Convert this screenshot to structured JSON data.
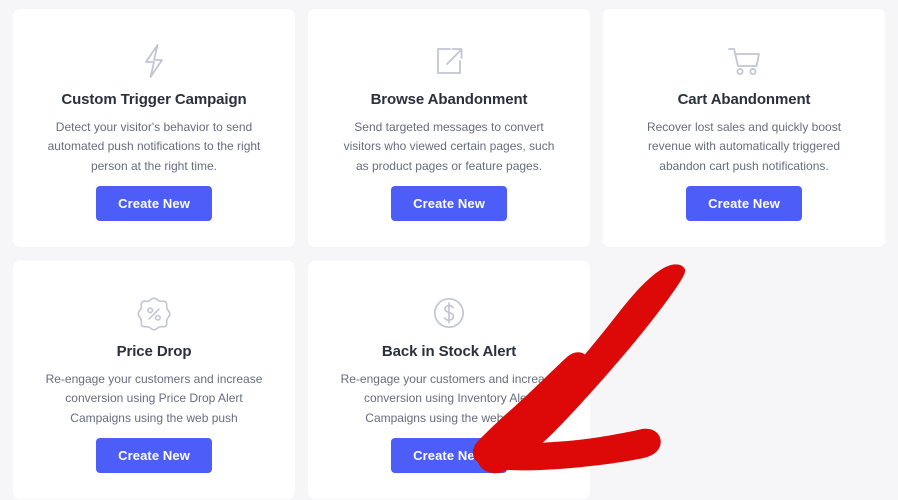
{
  "theme": {
    "page_background": "#f6f6f9",
    "card_background": "#ffffff",
    "button_color": "#4c5ef7",
    "button_text_color": "#ffffff",
    "title_color": "#29303e",
    "description_color": "#676d7d",
    "icon_color": "#c3c5d4",
    "annotation_color": "#dd0808"
  },
  "cards": [
    {
      "icon": "lightning-bolt-icon",
      "title": "Custom Trigger Campaign",
      "description": "Detect your visitor's behavior to send automated push notifications to the right person at the right time.",
      "button_label": "Create New"
    },
    {
      "icon": "external-link-icon",
      "title": "Browse Abandonment",
      "description": "Send targeted messages to convert visitors who viewed certain pages, such as product pages or feature pages.",
      "button_label": "Create New"
    },
    {
      "icon": "shopping-cart-icon",
      "title": "Cart Abandonment",
      "description": "Recover lost sales and quickly boost revenue with automatically triggered abandon cart push notifications.",
      "button_label": "Create New"
    },
    {
      "icon": "percent-badge-icon",
      "title": "Price Drop",
      "description": "Re-engage your customers and increase conversion using Price Drop Alert Campaigns using the web push",
      "button_label": "Create New"
    },
    {
      "icon": "dollar-circle-icon",
      "title": "Back in Stock Alert",
      "description": "Re-engage your customers and increase conversion using Inventory Alert Campaigns using the web push",
      "button_label": "Create New"
    }
  ],
  "annotation": {
    "name": "red-arrow-annotation",
    "points_to": "Back in Stock Alert Create New button"
  }
}
